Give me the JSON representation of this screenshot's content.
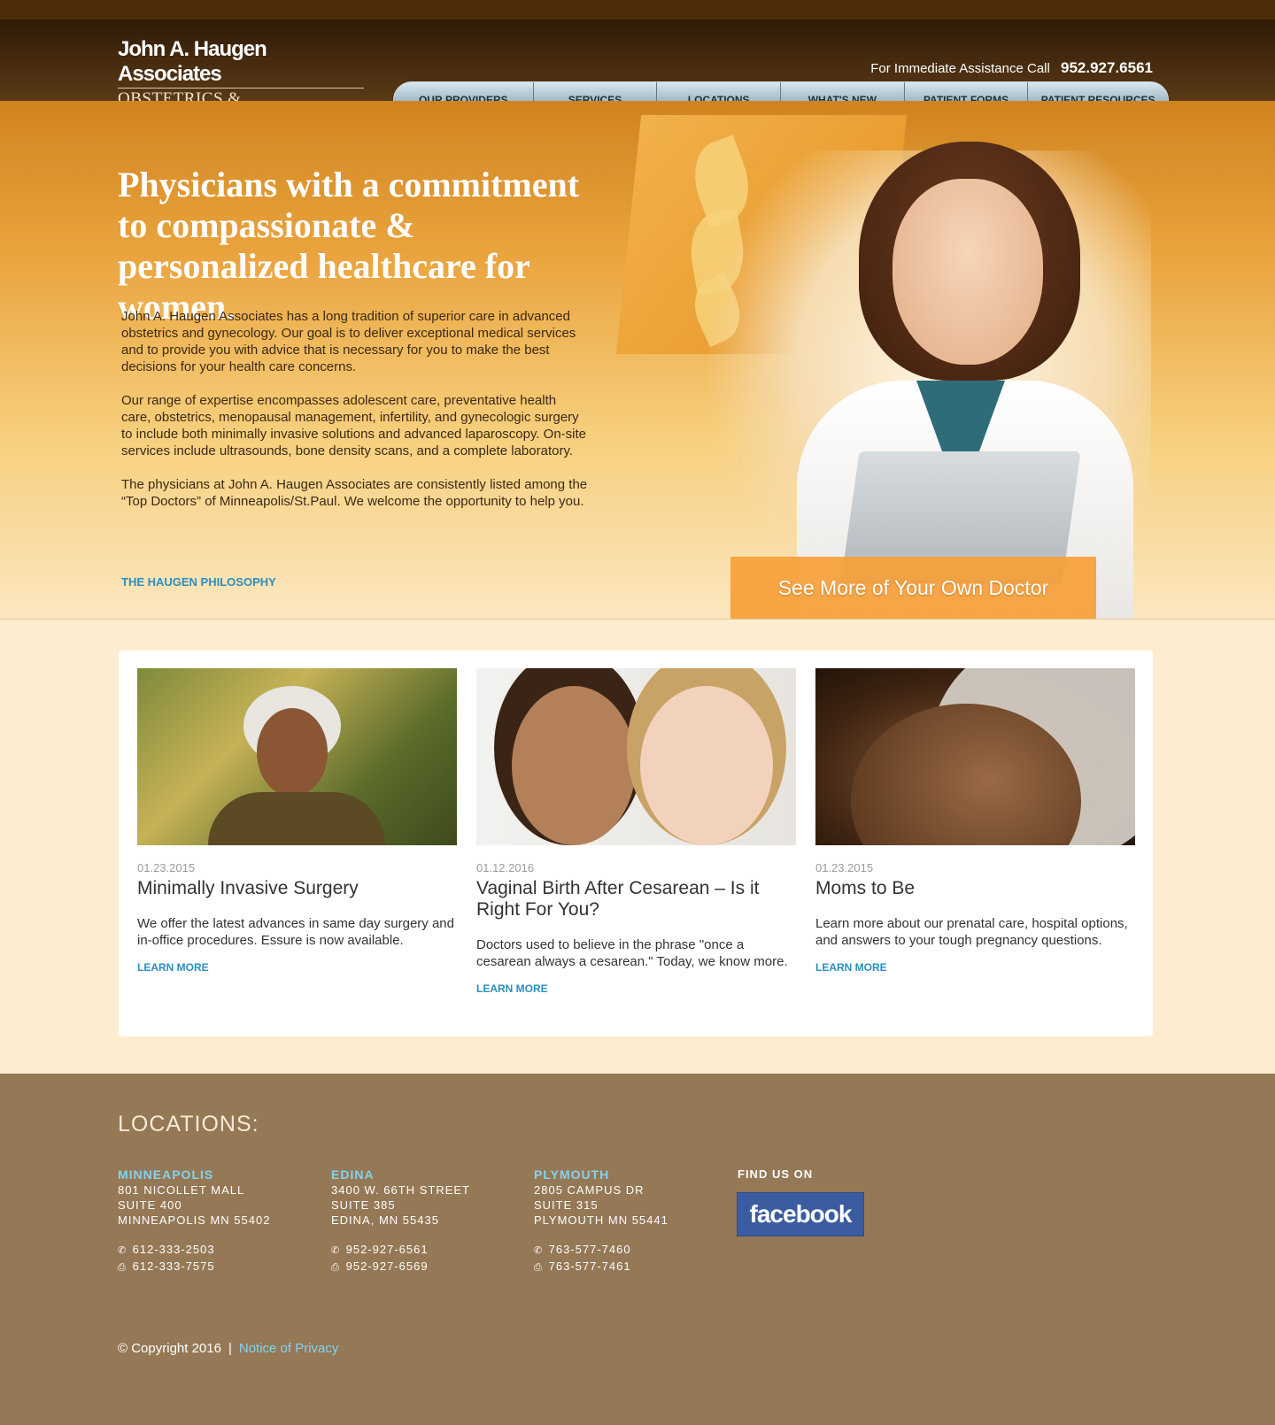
{
  "header": {
    "logo_name": "John A. Haugen Associates",
    "logo_sub": "OBSTETRICS & GYNEGOLOGY",
    "assist_label": "For Immediate Assistance Call",
    "assist_phone": "952.927.6561"
  },
  "nav": {
    "items": [
      {
        "label": "OUR PROVIDERS"
      },
      {
        "label": "SERVICES"
      },
      {
        "label": "LOCATIONS"
      },
      {
        "label": "WHAT'S NEW"
      },
      {
        "label": "PATIENT FORMS"
      },
      {
        "label": "PATIENT RESOURCES"
      }
    ]
  },
  "hero": {
    "title": "Physicians with a commitment to compassionate & personalized healthcare for women.",
    "paragraphs": [
      "John A. Haugen Associates has a long tradition of superior care in advanced obstetrics and gynecology. Our goal is to deliver exceptional medical services and to provide you with advice that is necessary for you to make the best decisions for your health care concerns.",
      "Our range of expertise encompasses adolescent care, preventative health care, obstetrics, menopausal management, infertility, and gynecologic surgery to include both minimally invasive solutions and advanced laparoscopy. On-site services include ultrasounds, bone density scans, and a complete laboratory.",
      "The physicians at John A. Haugen Associates are consistently listed among the “Top Doctors” of Minneapolis/St.Paul. We welcome the opportunity to help you."
    ],
    "link": "THE HAUGEN PHILOSOPHY",
    "cta": "See More of Your Own Doctor"
  },
  "articles": [
    {
      "date": "01.23.2015",
      "title": "Minimally Invasive Surgery",
      "text": "We offer the latest advances in same day surgery and in-office procedures. Essure is now available.",
      "link": "LEARN MORE"
    },
    {
      "date": "01.12.2016",
      "title": "Vaginal Birth After Cesarean – Is it Right For You?",
      "text": "Doctors used to believe in the phrase \"once a cesarean always a cesarean.\" Today, we know more.",
      "link": "LEARN MORE"
    },
    {
      "date": "01.23.2015",
      "title": "Moms to Be",
      "text": "Learn more about our prenatal care, hospital options, and answers to your tough pregnancy questions.",
      "link": "LEARN MORE"
    }
  ],
  "footer": {
    "locations_heading": "LOCATIONS:",
    "locations": [
      {
        "name": "MINNEAPOLIS",
        "line1": "801 NICOLLET MALL",
        "line2": "SUITE 400",
        "line3": "MINNEAPOLIS MN 55402",
        "phone": "612-333-2503",
        "fax": "612-333-7575"
      },
      {
        "name": "EDINA",
        "line1": "3400 W. 66TH STREET",
        "line2": "SUITE 385",
        "line3": "EDINA, MN 55435",
        "phone": "952-927-6561",
        "fax": "952-927-6569"
      },
      {
        "name": "PLYMOUTH",
        "line1": "2805 CAMPUS DR",
        "line2": "SUITE 315",
        "line3": "PLYMOUTH MN 55441",
        "phone": "763-577-7460",
        "fax": "763-577-7461"
      }
    ],
    "find_us": "FIND US ON",
    "facebook": "facebook",
    "copyright": "© Copyright 2016",
    "separator": "|",
    "privacy": "Notice of Privacy"
  },
  "icons": {
    "phone": "phone-icon",
    "fax": "fax-icon"
  },
  "colors": {
    "accent_blue": "#2b8fbf",
    "footer_brown": "#957855",
    "location_name": "#82d3f0",
    "facebook_blue": "#3b5ca0"
  }
}
